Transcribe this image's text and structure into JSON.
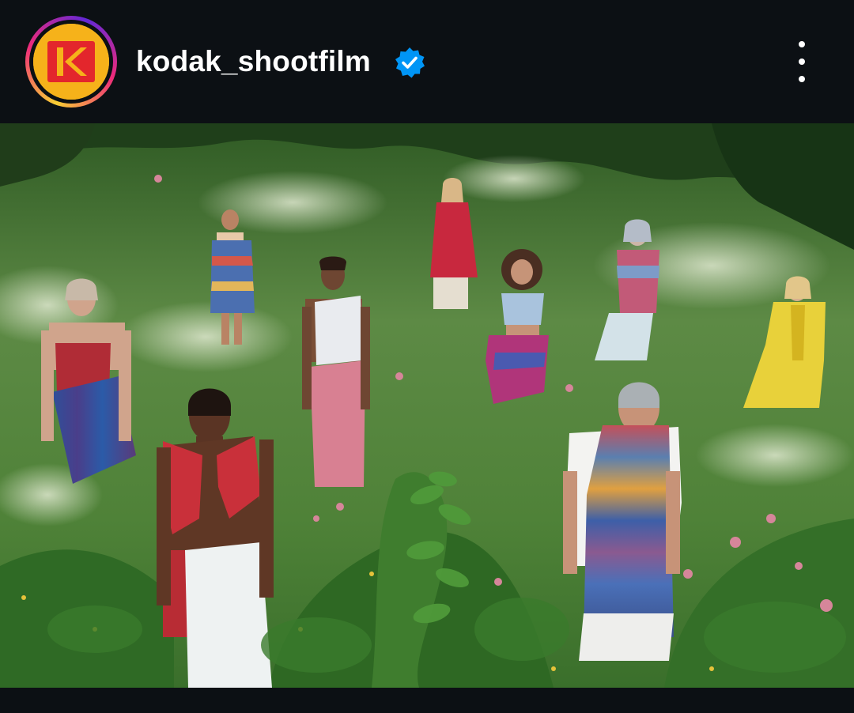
{
  "header": {
    "username": "kodak_shootfilm",
    "avatar_icon": "kodak-logo-icon",
    "verified_icon": "verified-badge-icon",
    "more_icon": "more-vertical-icon"
  },
  "post": {
    "image_icon": "post-photo"
  },
  "colors": {
    "background": "#0c1014",
    "verified": "#0095f6",
    "kodak_yellow": "#f6b21a",
    "kodak_red": "#e3262c"
  }
}
